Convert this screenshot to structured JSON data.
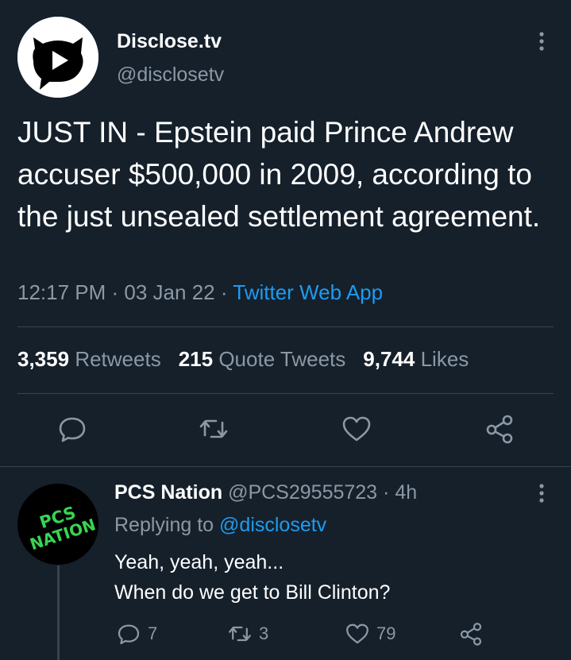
{
  "tweet": {
    "author": {
      "display_name": "Disclose.tv",
      "handle": "@disclosetv",
      "avatar_icon": "play-logo-icon"
    },
    "text": "JUST IN - Epstein paid Prince Andrew accuser $500,000 in 2009, according to the just unsealed settlement agreement.",
    "time": "12:17 PM",
    "date": "03 Jan 22",
    "separator": " · ",
    "source": "Twitter Web App",
    "stats": {
      "retweets_count": "3,359",
      "retweets_label": "Retweets",
      "quotes_count": "215",
      "quotes_label": "Quote Tweets",
      "likes_count": "9,744",
      "likes_label": "Likes"
    },
    "actions": [
      "reply-icon",
      "retweet-icon",
      "like-icon",
      "share-icon"
    ]
  },
  "reply": {
    "author": {
      "display_name": "PCS Nation",
      "handle": "@PCS29555723",
      "age": "4h",
      "avatar_text_line1": "PCS",
      "avatar_text_line2": "NATION"
    },
    "replying_prefix": "Replying to",
    "replying_to": "@disclosetv",
    "text_line1": "Yeah, yeah, yeah...",
    "text_line2": "When do we get to Bill Clinton?",
    "reply_count": "7",
    "retweet_count": "3",
    "like_count": "79"
  },
  "colors": {
    "background": "#15202b",
    "secondary_text": "#8b98a5",
    "accent": "#1d9bf0",
    "divider": "#38444d",
    "avatar_text": "#39d353"
  }
}
